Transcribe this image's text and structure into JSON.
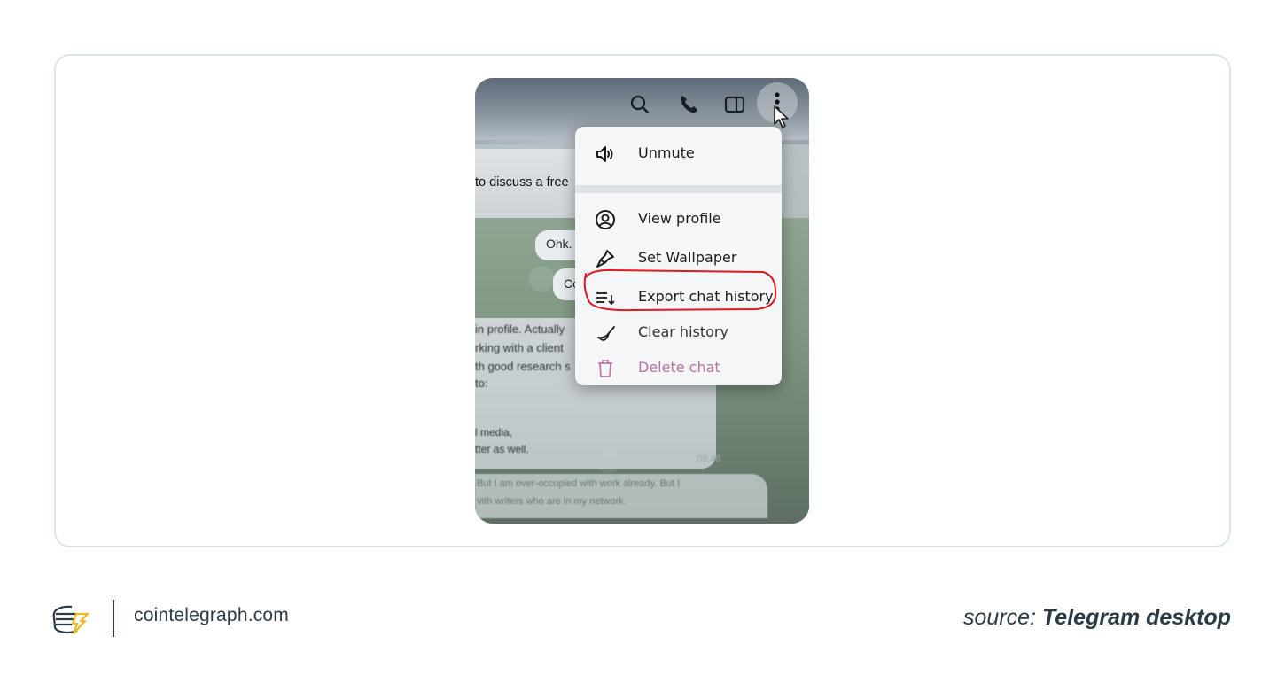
{
  "screenshot": {
    "top_icons": [
      "search-icon",
      "phone-icon",
      "sidebar-toggle-icon",
      "more-vertical-icon"
    ],
    "chat_snippets": {
      "header_line": "to discuss a free",
      "bubble_1": "Ohk.",
      "bubble_2": "Co",
      "message_lines": [
        "in profile. Actually",
        "rking with a client",
        "th good research s",
        "to:",
        "l media,",
        "tter as well."
      ],
      "message_time": "09:48",
      "reply_lines": [
        "But I am over-occupied with work already. But I",
        "vith writers who are in my network."
      ]
    },
    "menu": {
      "items": [
        {
          "label": "Unmute",
          "icon": "speaker-icon"
        },
        {
          "label": "View profile",
          "icon": "profile-icon"
        },
        {
          "label": "Set Wallpaper",
          "icon": "brush-icon"
        },
        {
          "label": "Export chat history",
          "icon": "export-icon",
          "highlighted": true
        },
        {
          "label": "Clear history",
          "icon": "broom-icon"
        },
        {
          "label": "Delete chat",
          "icon": "trash-icon"
        }
      ]
    },
    "highlight_color": "#e0181f"
  },
  "footer": {
    "site": "cointelegraph.com",
    "source_prefix": "source: ",
    "source_name": "Telegram desktop"
  },
  "colors": {
    "card_border": "#dce6e6",
    "footer_text": "#2b3a45",
    "logo_accent": "#f2b824"
  }
}
